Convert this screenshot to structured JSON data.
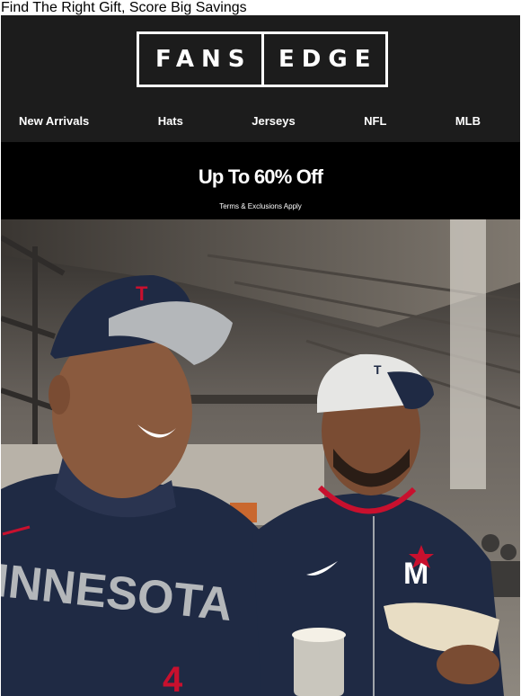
{
  "preheader": "Find The Right Gift, Score Big Savings",
  "brand": {
    "logo_left": "FANS",
    "logo_right": "EDGE"
  },
  "nav": [
    "New Arrivals",
    "Hats",
    "Jerseys",
    "NFL",
    "MLB"
  ],
  "promo": {
    "headline": "Up To 60% Off",
    "terms": "Terms & Exclusions Apply"
  },
  "hero": {
    "jersey_text": "INNESOTA",
    "jersey_number": "4",
    "jacket_letter": "M",
    "colors": {
      "navy": "#1f2a44",
      "red": "#c8102e",
      "gray": "#b4b7ba"
    }
  }
}
